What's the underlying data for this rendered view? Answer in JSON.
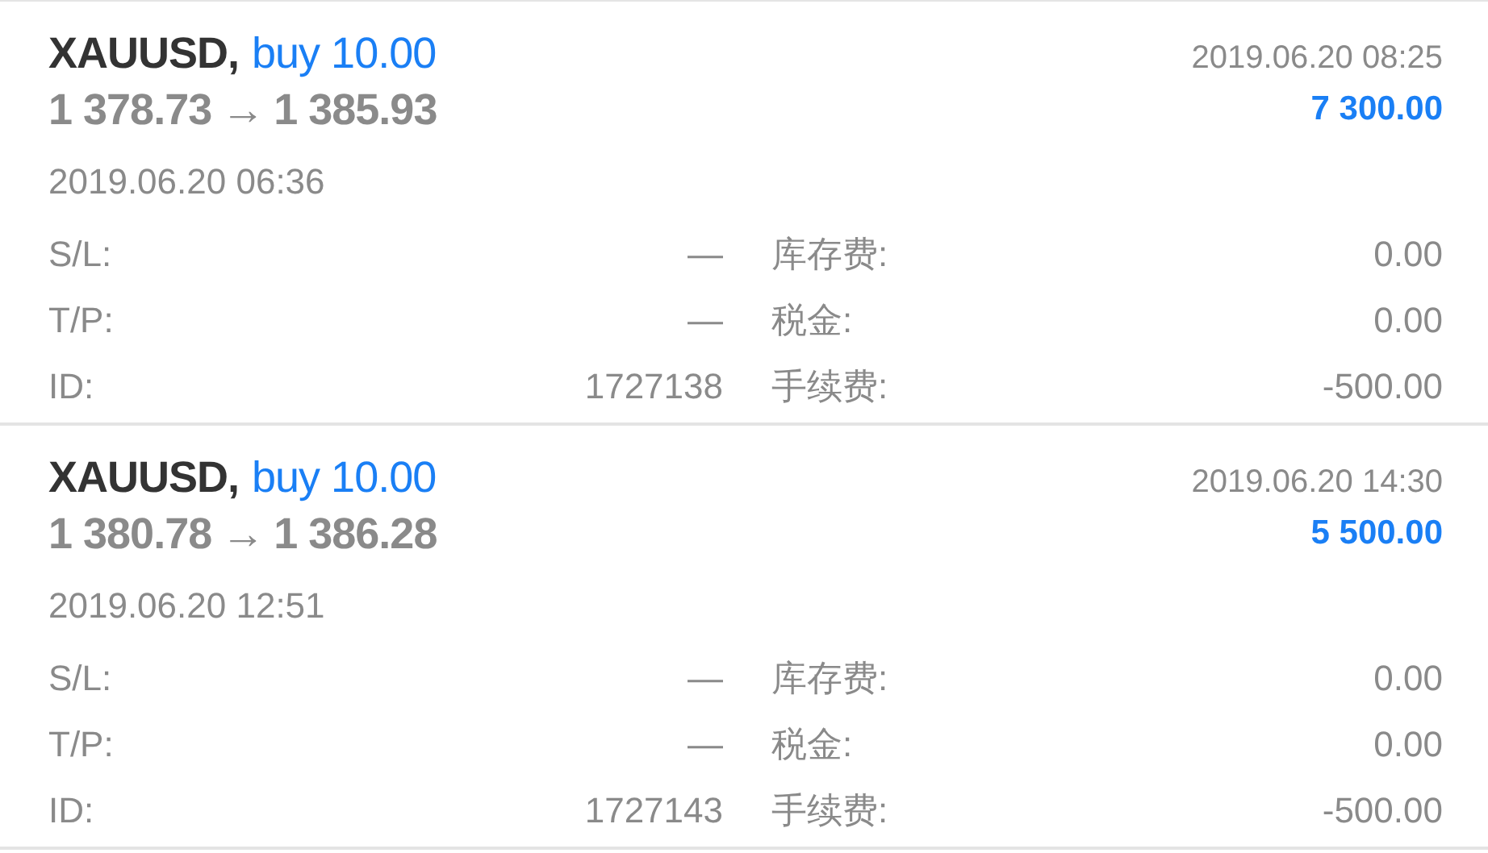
{
  "deals": [
    {
      "symbol": "XAUUSD,",
      "side": "buy 10.00",
      "open_price": "1 378.73",
      "arrow": "→",
      "close_price": "1 385.93",
      "close_time": "2019.06.20 08:25",
      "profit": "7 300.00",
      "open_time": "2019.06.20 06:36",
      "fields": [
        {
          "label": "S/L:",
          "value": "—",
          "label2": "库存费:",
          "value2": "0.00"
        },
        {
          "label": "T/P:",
          "value": "—",
          "label2": "税金:",
          "value2": "0.00"
        },
        {
          "label": "ID:",
          "value": "1727138",
          "label2": "手续费:",
          "value2": "-500.00"
        }
      ]
    },
    {
      "symbol": "XAUUSD,",
      "side": "buy 10.00",
      "open_price": "1 380.78",
      "arrow": "→",
      "close_price": "1 386.28",
      "close_time": "2019.06.20 14:30",
      "profit": "5 500.00",
      "open_time": "2019.06.20 12:51",
      "fields": [
        {
          "label": "S/L:",
          "value": "—",
          "label2": "库存费:",
          "value2": "0.00"
        },
        {
          "label": "T/P:",
          "value": "—",
          "label2": "税金:",
          "value2": "0.00"
        },
        {
          "label": "ID:",
          "value": "1727143",
          "label2": "手续费:",
          "value2": "-500.00"
        }
      ]
    }
  ]
}
